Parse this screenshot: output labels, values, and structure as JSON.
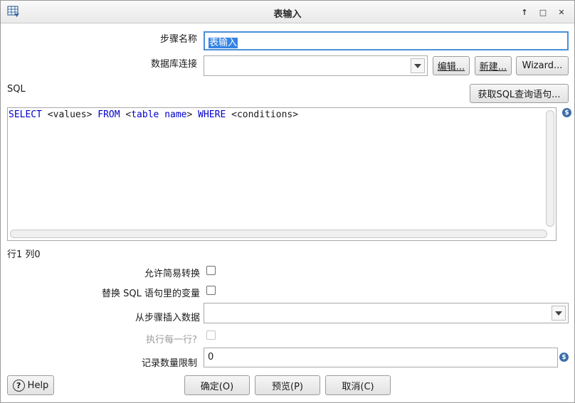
{
  "window": {
    "title": "表输入",
    "controls": [
      "↑",
      "□",
      "✕"
    ]
  },
  "form": {
    "step_name_label": "步骤名称",
    "step_name_value": "表输入",
    "db_connection_label": "数据库连接",
    "db_connection_value": "",
    "edit_button": "编辑...",
    "new_button": "新建...",
    "wizard_button": "Wizard...",
    "sql_label": "SQL",
    "get_sql_button": "获取SQL查询语句...",
    "sql": {
      "t1": "SELECT",
      "t2": " <values> ",
      "t3": "FROM",
      "t4": " <",
      "t5": "table",
      "t6": " ",
      "t7": "name",
      "t8": "> ",
      "t9": "WHERE",
      "t10": " <conditions>"
    },
    "cursor_pos": "行1 列0",
    "allow_lazy_conversion_label": "允许简易转换",
    "replace_variables_label": "替换 SQL 语句里的变量",
    "insert_data_from_step_label": "从步骤插入数据",
    "insert_data_from_step_value": "",
    "execute_each_row_label": "执行每一行?",
    "limit_size_label": "记录数量限制",
    "limit_size_value": "0"
  },
  "footer": {
    "help_button": "Help",
    "ok_button": "确定(O)",
    "preview_button": "预览(P)",
    "cancel_button": "取消(C)"
  },
  "icons": {
    "app": "table-input-icon",
    "variable": "dollar-icon"
  }
}
